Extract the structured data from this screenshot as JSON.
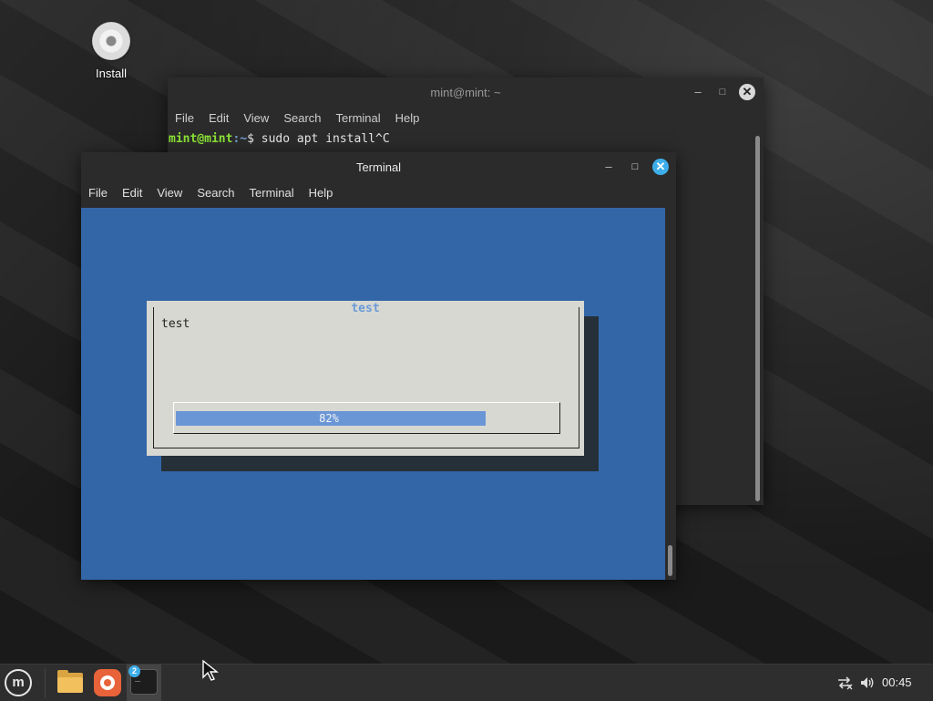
{
  "desktop": {
    "icons": [
      {
        "label": "Install",
        "icon": "disc-icon"
      }
    ]
  },
  "back_window": {
    "title": "mint@mint: ~",
    "menu": [
      "File",
      "Edit",
      "View",
      "Search",
      "Terminal",
      "Help"
    ],
    "prompt_user": "mint@mint",
    "prompt_path": ":~",
    "prompt_symbol": "$ ",
    "command": "sudo apt install^C"
  },
  "front_window": {
    "title": "Terminal",
    "menu": [
      "File",
      "Edit",
      "View",
      "Search",
      "Terminal",
      "Help"
    ],
    "dialog": {
      "title": "test",
      "text": "test",
      "progress_percent": 82,
      "progress_label": "82%"
    },
    "background_color": "#3366a7"
  },
  "taskbar": {
    "menu_logo": "m",
    "apps": [
      {
        "name": "files",
        "icon": "folder-icon"
      },
      {
        "name": "firefox",
        "icon": "firefox-icon"
      },
      {
        "name": "terminal",
        "icon": "terminal-icon",
        "badge": "2",
        "glyph": "_"
      }
    ],
    "tray": {
      "network_icon": "network-disconnected-icon",
      "volume_icon": "volume-icon"
    },
    "clock": "00:45"
  }
}
